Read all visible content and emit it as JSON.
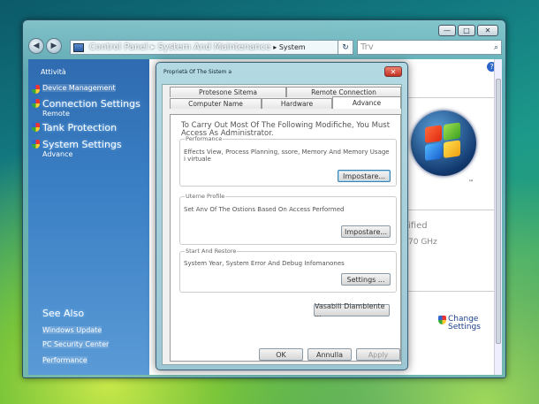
{
  "window": {
    "controls": [
      "—",
      "□",
      "✕"
    ],
    "address": {
      "crumb": "Control Panel ▸ System And Maintenance",
      "crumb2": "▸ System",
      "dropdown": "▾"
    },
    "refresh": "↻",
    "search_placeholder": "Trv",
    "search_icon": "⌕"
  },
  "left_pane": {
    "title": "Attività",
    "tasks": [
      {
        "label": "Device Management",
        "sub": ""
      },
      {
        "label": "Connection Settings",
        "sub": "Remote"
      },
      {
        "label": "Tank Protection",
        "sub": ""
      },
      {
        "label": "System Settings",
        "sub": "Advance"
      }
    ],
    "see_also_title": "See Also",
    "see_also": [
      "Windows Update",
      "PC Security Center",
      "Performance"
    ]
  },
  "content": {
    "help": "?",
    "tm": "™",
    "fragments": [
      "ified",
      "70 GHz"
    ],
    "change_settings": "Change\nSettings"
  },
  "dialog": {
    "title": "Proprietà Of The Sistem",
    "title_suffix": "a",
    "close": "✕",
    "tabs_row1": [
      "Protesone Sitema",
      "Remote Connection"
    ],
    "tabs_row2": [
      "Computer Name",
      "Hardware",
      "Advance"
    ],
    "note": "To Carry Out Most Of The Following Modifiche, You Must Access As Administrator.",
    "groups": [
      {
        "label": "Performance",
        "text": "Effects View, Process Planning, ssore, Memory And Memory Usage i virtuale",
        "button": "Impostare..."
      },
      {
        "label": "Uterne Profile",
        "text": "Set Anv Of The Ostions Based On Access Performed",
        "button": "Impostare..."
      },
      {
        "label": "Start And Restore",
        "text": "System Year, System Error And Debug Infomanones",
        "button": "Settings ..."
      }
    ],
    "env_button": "Vasabili Diambiente ...",
    "ok": "OK",
    "cancel": "Annulla",
    "apply": "Apply"
  }
}
